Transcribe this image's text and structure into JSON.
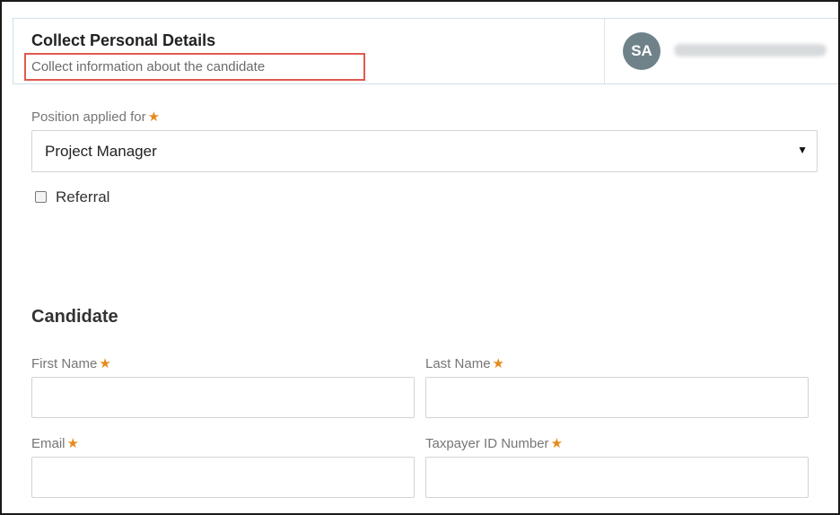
{
  "header": {
    "title": "Collect Personal Details",
    "subtitle": "Collect information about the candidate",
    "avatar_initials": "SA"
  },
  "position": {
    "label": "Position applied for",
    "required_mark": "★",
    "selected_value": "Project Manager",
    "arrow": "▼"
  },
  "referral": {
    "label": "Referral",
    "checked": false
  },
  "candidate": {
    "section_title": "Candidate",
    "fields": {
      "first_name": {
        "label": "First Name",
        "value": ""
      },
      "last_name": {
        "label": "Last Name",
        "value": ""
      },
      "email": {
        "label": "Email",
        "value": ""
      },
      "taxpayer_id": {
        "label": "Taxpayer ID Number",
        "value": ""
      }
    }
  },
  "colors": {
    "required_star": "#e68a1d",
    "highlight_box": "#e05a4f",
    "avatar_bg": "#6f8289"
  }
}
